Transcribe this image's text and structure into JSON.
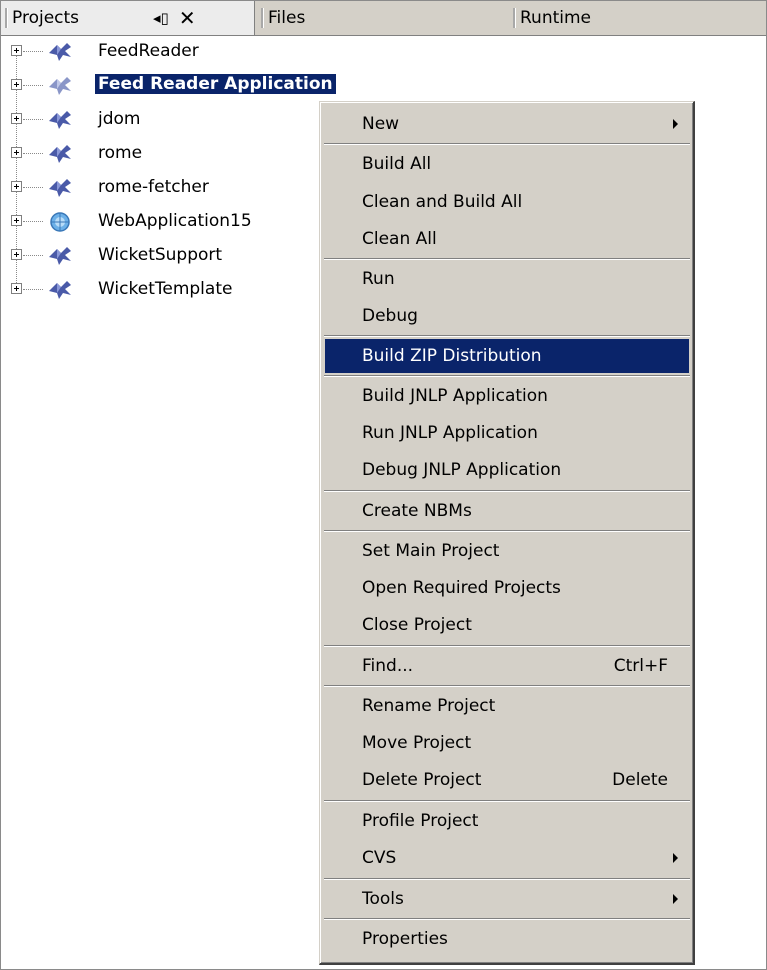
{
  "tabs": {
    "projects": "Projects",
    "files": "Files",
    "runtime": "Runtime",
    "projects_controls": [
      "minimize-icon",
      "close-icon"
    ]
  },
  "tree": {
    "nodes": [
      {
        "label": "FeedReader",
        "icon": "project-icon",
        "selected": false
      },
      {
        "label": "Feed Reader Application",
        "icon": "project-icon",
        "selected": true
      },
      {
        "label": "jdom",
        "icon": "project-icon",
        "selected": false
      },
      {
        "label": "rome",
        "icon": "project-icon",
        "selected": false
      },
      {
        "label": "rome-fetcher",
        "icon": "project-icon",
        "selected": false
      },
      {
        "label": "WebApplication15",
        "icon": "web-project-icon",
        "selected": false
      },
      {
        "label": "WicketSupport",
        "icon": "project-icon",
        "selected": false
      },
      {
        "label": "WicketTemplate",
        "icon": "project-icon",
        "selected": false
      }
    ]
  },
  "menu": {
    "items": [
      {
        "label": "New",
        "submenu": true
      },
      {
        "label": "Build All"
      },
      {
        "label": "Clean and Build All"
      },
      {
        "label": "Clean All"
      },
      {
        "label": "Run"
      },
      {
        "label": "Debug"
      },
      {
        "label": "Build ZIP Distribution",
        "highlighted": true
      },
      {
        "label": "Build JNLP Application"
      },
      {
        "label": "Run JNLP Application"
      },
      {
        "label": "Debug JNLP Application"
      },
      {
        "label": "Create NBMs"
      },
      {
        "label": "Set Main Project"
      },
      {
        "label": "Open Required Projects"
      },
      {
        "label": "Close Project"
      },
      {
        "label": "Find...",
        "shortcut": "Ctrl+F"
      },
      {
        "label": "Rename Project"
      },
      {
        "label": "Move Project"
      },
      {
        "label": "Delete Project",
        "shortcut": "Delete"
      },
      {
        "label": "Profile Project"
      },
      {
        "label": "CVS",
        "submenu": true
      },
      {
        "label": "Tools",
        "submenu": true
      },
      {
        "label": "Properties"
      }
    ]
  },
  "colors": {
    "selection": "#0a246a",
    "menu_background": "#d4d0c8",
    "project_icon": "#4a5aa8"
  }
}
